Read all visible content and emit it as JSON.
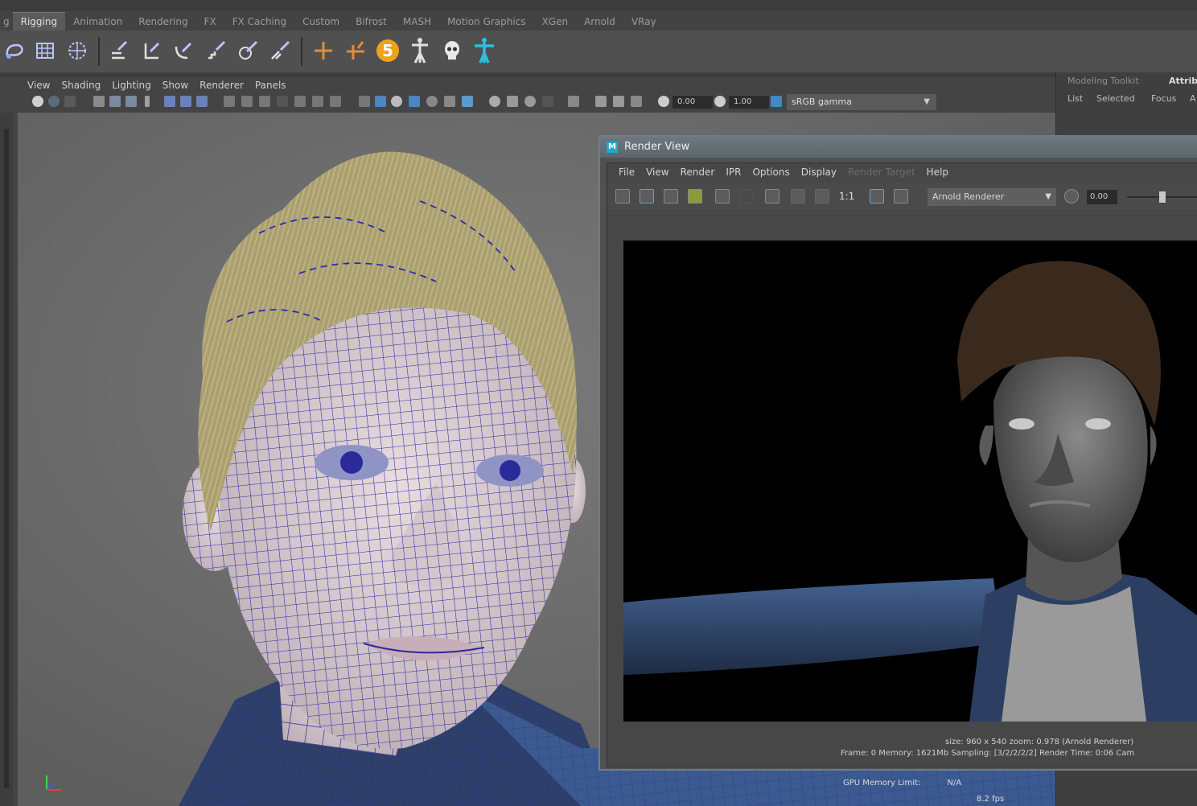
{
  "shelf": {
    "tabs": [
      "g",
      "Rigging",
      "Animation",
      "Rendering",
      "FX",
      "FX Caching",
      "Custom",
      "Bifrost",
      "MASH",
      "Motion Graphics",
      "XGen",
      "Arnold",
      "VRay"
    ],
    "active_tab": "Rigging"
  },
  "panel": {
    "menu": [
      "View",
      "Shading",
      "Lighting",
      "Show",
      "Renderer",
      "Panels"
    ],
    "near_clip": "0.00",
    "exposure": "1.00",
    "color_space": "sRGB gamma"
  },
  "right_panel": {
    "tabs": [
      "Modeling Toolkit",
      "Attrib"
    ],
    "sub": [
      "List",
      "Selected",
      "Focus",
      "A"
    ]
  },
  "render_view": {
    "title": "Render View",
    "menu": [
      "File",
      "View",
      "Render",
      "IPR",
      "Options",
      "Display",
      "Render Target",
      "Help"
    ],
    "ratio_label": "1:1",
    "renderer": "Arnold Renderer",
    "exposure_value": "0.00",
    "status_line1": "size: 960 x 540  zoom: 0.978     (Arnold Renderer)",
    "status_line2": "Frame: 0    Memory: 1621Mb    Sampling: [3/2/2/2/2]    Render Time: 0:06    Cam"
  },
  "viewport": {
    "gpu_label": "GPU Memory Limit:",
    "gpu_value": "N/A",
    "fps": "8.2 fps"
  },
  "colors": {
    "accent_cyan": "#22a9c9",
    "wire_blue": "#2a2a9a",
    "hair": "#b5a876"
  }
}
